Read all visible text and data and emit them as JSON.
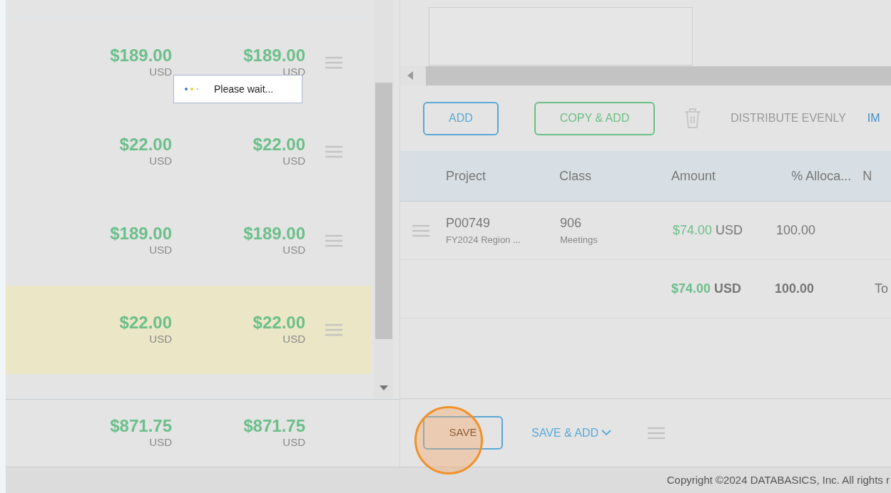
{
  "expense_rows": [
    {
      "amount": "$189.00",
      "currency": "USD",
      "amount_2": "$189.00",
      "currency_2": "USD",
      "selected": false
    },
    {
      "amount": "$22.00",
      "currency": "USD",
      "amount_2": "$22.00",
      "currency_2": "USD",
      "selected": false
    },
    {
      "amount": "$189.00",
      "currency": "USD",
      "amount_2": "$189.00",
      "currency_2": "USD",
      "selected": false
    },
    {
      "amount": "$22.00",
      "currency": "USD",
      "amount_2": "$22.00",
      "currency_2": "USD",
      "selected": true
    }
  ],
  "loading_popup": {
    "text": "Please wait..."
  },
  "expense_totals": {
    "amount": "$871.75",
    "currency": "USD",
    "amount_2": "$871.75",
    "currency_2": "USD"
  },
  "allocation_toolbar": [
    {
      "kind": "outlined",
      "label": "ADD",
      "color": "#5aa9d6",
      "disabled": false
    },
    {
      "kind": "outlined",
      "label": "COPY & ADD",
      "color": "#6cbf84",
      "disabled": false
    },
    {
      "kind": "trash",
      "disabled": true
    },
    {
      "kind": "text",
      "label": "DISTRIBUTE EVENLY",
      "disabled": true
    },
    {
      "kind": "text",
      "label": "IM",
      "disabled": false
    }
  ],
  "allocation_table": {
    "columns": [
      "Project",
      "Class",
      "Amount",
      "% Alloca...",
      "N"
    ],
    "rows": [
      {
        "project": "P00749",
        "project_name": "FY2024 Region ...",
        "class": "906",
        "class_name": "Meetings",
        "amount": "$74.00",
        "currency": "USD",
        "percent": "100.00"
      }
    ],
    "totals": {
      "amount": "$74.00",
      "currency": "USD",
      "percent": "100.00",
      "label": "To"
    }
  },
  "footer_actions": {
    "save": "SAVE",
    "save_and_add": "SAVE & ADD"
  },
  "copyright": "Copyright ©2024 DATABASICS, Inc. All rights r"
}
